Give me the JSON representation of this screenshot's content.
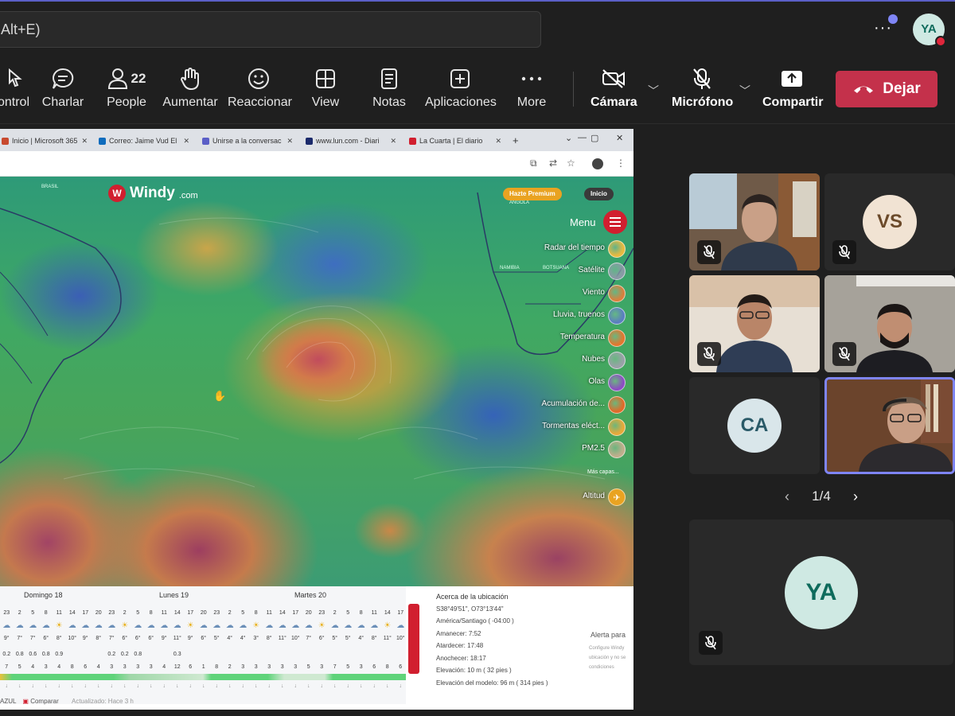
{
  "titlebar": {
    "search_text": "Alt+E)",
    "more_label": "···",
    "user_initials": "YA"
  },
  "toolbar": {
    "items": [
      {
        "label": "ontrol"
      },
      {
        "label": "Charlar"
      },
      {
        "label": "People",
        "count": "22"
      },
      {
        "label": "Aumentar"
      },
      {
        "label": "Reaccionar"
      },
      {
        "label": "View"
      },
      {
        "label": "Notas"
      },
      {
        "label": "Aplicaciones"
      },
      {
        "label": "More"
      },
      {
        "label": "Cámara"
      },
      {
        "label": "Micrófono"
      },
      {
        "label": "Compartir"
      }
    ],
    "leave_label": "Dejar"
  },
  "browser": {
    "tabs": [
      "Inicio | Microsoft 365",
      "Correo: Jaime Vud El",
      "Unirse a la conversac",
      "www.lun.com - Diari",
      "La Cuarta | El diario"
    ],
    "new_tab": "+",
    "window_controls": [
      "⌄",
      "—",
      "▢",
      "✕"
    ]
  },
  "windy": {
    "logo_word": "Windy",
    "logo_suffix": ".com",
    "premium_label": "Hazte Premium",
    "login_label": "Inicio",
    "menu_label": "Menu",
    "layers": [
      {
        "label": "Radar del tiempo",
        "color": "#e8b940"
      },
      {
        "label": "Satélite",
        "color": "#8a9aa6"
      },
      {
        "label": "Viento",
        "color": "#d9803e"
      },
      {
        "label": "Lluvia, truenos",
        "color": "#5b7fbf"
      },
      {
        "label": "Temperatura",
        "color": "#e3772f"
      },
      {
        "label": "Nubes",
        "color": "#9aa1a8"
      },
      {
        "label": "Olas",
        "color": "#8c4ec2"
      },
      {
        "label": "Acumulación de...",
        "color": "#e06b2a"
      },
      {
        "label": "Tormentas eléct...",
        "color": "#e6a93a"
      },
      {
        "label": "PM2.5",
        "color": "#bfae8c"
      }
    ],
    "more_layers_label": "Más capas...",
    "altitude_label": "Altitud",
    "map_labels": {
      "angola": "ANGOLA",
      "namibia": "NAMIBIA",
      "botswana": "BOTSUANA",
      "brasil": "BRASIL"
    }
  },
  "forecast": {
    "days": [
      "Domingo 18",
      "Lunes 19",
      "Martes 20"
    ],
    "hours": [
      "23",
      "2",
      "5",
      "8",
      "11",
      "14",
      "17",
      "20",
      "23",
      "2",
      "5",
      "8",
      "11",
      "14",
      "17",
      "20",
      "23",
      "2",
      "5",
      "8",
      "11",
      "14",
      "17",
      "20",
      "23",
      "2",
      "5",
      "8",
      "11",
      "14",
      "17"
    ],
    "temps": [
      "9°",
      "7°",
      "7°",
      "6°",
      "8°",
      "10°",
      "9°",
      "8°",
      "7°",
      "6°",
      "6°",
      "6°",
      "9°",
      "11°",
      "9°",
      "6°",
      "5°",
      "4°",
      "4°",
      "3°",
      "8°",
      "11°",
      "10°",
      "7°",
      "6°",
      "5°",
      "5°",
      "4°",
      "8°",
      "11°",
      "10°"
    ],
    "rain": [
      "0.2",
      "0.8",
      "0.6",
      "0.8",
      "0.9",
      "",
      "",
      "",
      "0.2",
      "0.2",
      "0.8",
      "",
      "",
      "0.3",
      "",
      "",
      "",
      "",
      "",
      "",
      "",
      "",
      "",
      "",
      "",
      "",
      "",
      "",
      "",
      "",
      ""
    ],
    "wind": [
      "7",
      "5",
      "4",
      "3",
      "4",
      "8",
      "6",
      "4",
      "3",
      "3",
      "3",
      "3",
      "4",
      "12",
      "6",
      "1",
      "8",
      "2",
      "3",
      "3",
      "3",
      "3",
      "3",
      "5",
      "3",
      "7",
      "5",
      "3",
      "6",
      "8",
      "6"
    ],
    "location_header": "Acerca de la ubicación",
    "coords": "S38°49'51\", O73°13'44\"",
    "timezone": "América/Santiago ( -04:00 )",
    "sunrise": "Amanecer: 7:52",
    "sunset": "Atardecer: 17:48",
    "dusk": "Anochecer: 18:17",
    "elevation": "Elevación: 10 m ( 32 pies )",
    "model_elevation": "Elevación del modelo: 96 m ( 314 pies )",
    "alert_title": "Alerta para",
    "alert_sub": "Configure Windy ubicación y no se condiciones",
    "footer_left": "AZUL",
    "footer_compare": "Comparar",
    "footer_updated": "Actualizado: Hace 3 h"
  },
  "participants": {
    "tiles": [
      {
        "kind": "video",
        "name": "participant-video-1"
      },
      {
        "kind": "initials",
        "initials": "VS"
      },
      {
        "kind": "video",
        "name": "participant-video-2"
      },
      {
        "kind": "video",
        "name": "participant-video-3"
      },
      {
        "kind": "initials",
        "initials": "CA"
      },
      {
        "kind": "video",
        "name": "participant-video-4",
        "speaking": true
      }
    ],
    "pager": "1/4",
    "self_initials": "YA"
  }
}
